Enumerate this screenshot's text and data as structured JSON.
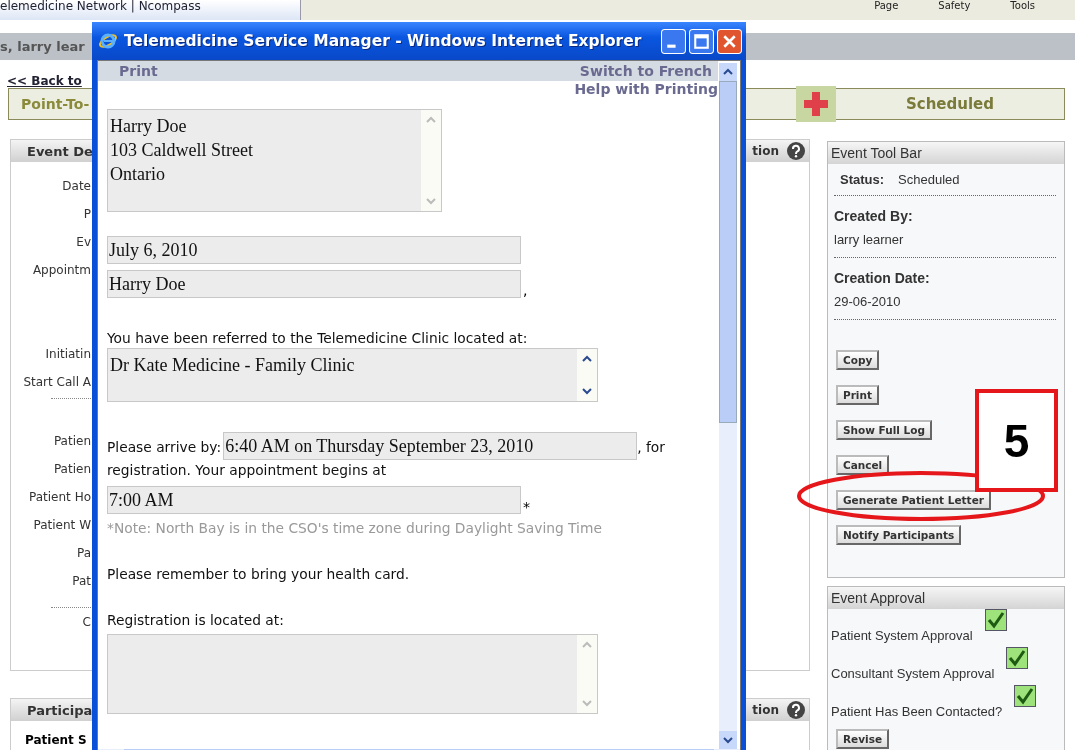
{
  "browser": {
    "tab_title": "elemedicine Network | Ncompass",
    "toolbar": [
      "Page",
      "Safety",
      "Tools"
    ]
  },
  "header": {
    "greeting": "s, larry lear"
  },
  "back_link": "<< Back to",
  "status_bar": {
    "title": "Point-To-",
    "status": "Scheduled"
  },
  "event_panel": {
    "title": "Event De",
    "title_right": "tion",
    "sections": [
      [
        "Date",
        "P",
        "Ev",
        "Appointm",
        "Initiatin",
        "Start Call A"
      ],
      [
        "Patien",
        "Patien",
        "Patient Ho",
        "Patient W",
        "Pa",
        "Pat"
      ],
      [
        "C"
      ]
    ]
  },
  "participants_panel": {
    "title": "Participa",
    "title_right": "tion",
    "first_label": "Patient S"
  },
  "tool_bar": {
    "title": "Event Tool Bar",
    "status_label": "Status:",
    "status_value": "Scheduled",
    "fields": [
      {
        "label": "Created By:",
        "value": "larry learner"
      },
      {
        "label": "Creation Date:",
        "value": "29-06-2010"
      }
    ],
    "buttons": [
      "Copy",
      "Print",
      "Show Full Log",
      "Cancel",
      "Generate Patient Letter",
      "Notify Participants"
    ]
  },
  "approval": {
    "title": "Event Approval",
    "items": [
      {
        "label": "Patient System Approval",
        "checked": true
      },
      {
        "label": "Consultant System Approval",
        "checked": true
      },
      {
        "label": "Patient Has Been Contacted?",
        "checked": true
      }
    ],
    "button": "Revise"
  },
  "callout": {
    "number": "5"
  },
  "popup": {
    "title": "Telemedicine Service Manager - Windows Internet Explorer",
    "print": "Print",
    "switch_language": "Switch to French",
    "help": "Help with Printing",
    "address": [
      "Harry Doe",
      "103 Caldwell Street",
      "Ontario"
    ],
    "date": "July 6, 2010",
    "name": "Harry Doe",
    "name_suffix": ",",
    "referred_text": "You have been referred to the Telemedicine Clinic located at:",
    "clinic": "Dr Kate Medicine - Family Clinic",
    "arrive_label": "Please arrive by:",
    "arrive_value": "6:40 AM on Thursday September 23, 2010",
    "arrive_after": ", for",
    "arrive_continued": "registration. Your appointment begins at",
    "appointment_time": "7:00 AM",
    "asterisk": "*",
    "note": "*Note: North Bay is in the CSO's time zone during Daylight Saving Time",
    "reminder": "Please remember to bring your health card.",
    "registration_label": "Registration is located at:"
  }
}
